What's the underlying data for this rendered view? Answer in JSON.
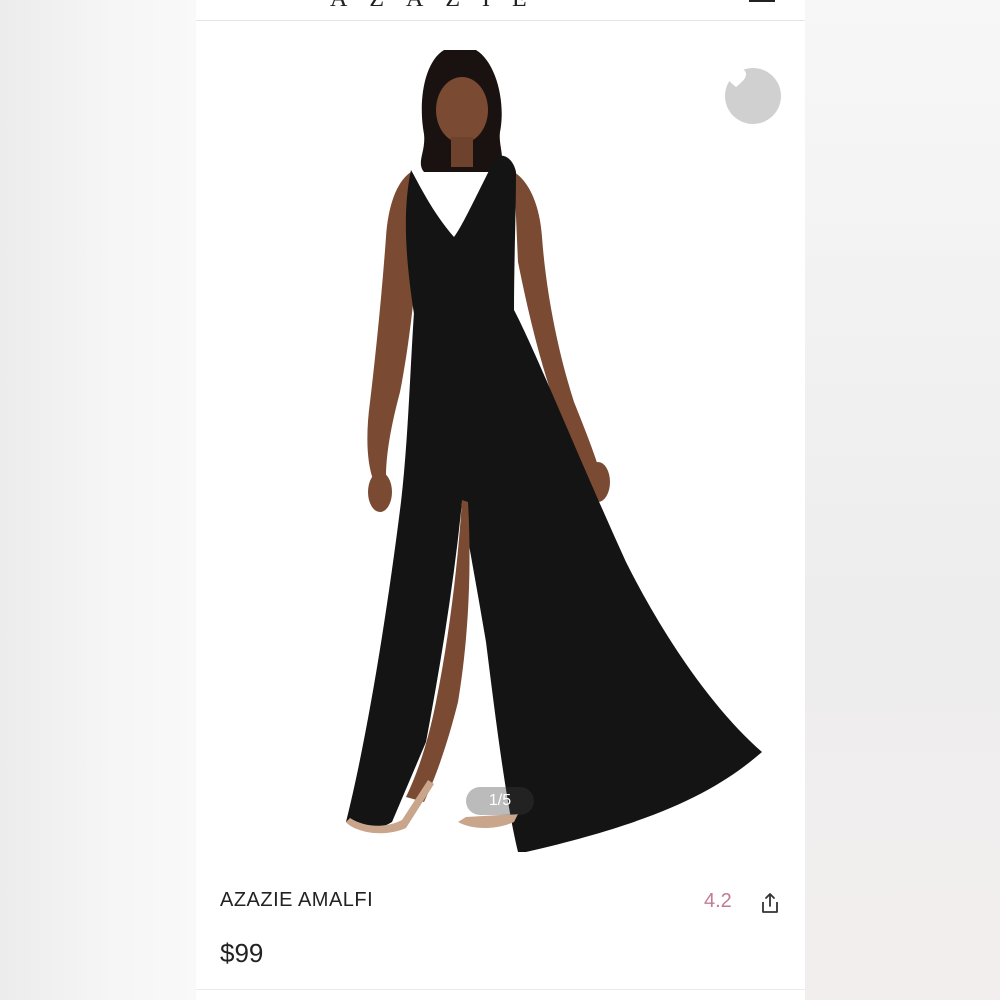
{
  "header": {
    "brand": "AZAZIE"
  },
  "gallery": {
    "page_indicator": "1/5",
    "favorite_icon": "heart-icon"
  },
  "product": {
    "name": "AZAZIE AMALFI",
    "rating": "4.2",
    "price": "$99",
    "share_icon": "share-icon"
  },
  "colors": {
    "rating": "#c27b93",
    "heart_button": "#d0d0d0",
    "dress": "#141414"
  }
}
